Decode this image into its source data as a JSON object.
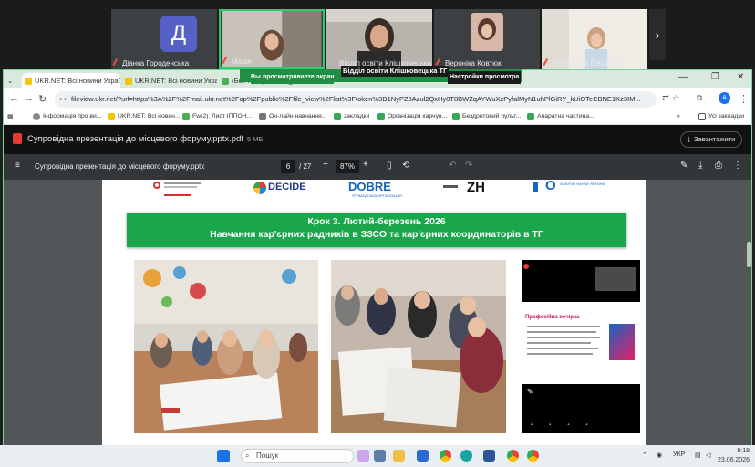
{
  "meeting": {
    "participants": [
      {
        "name": "Діанка Городенська",
        "initial": "Д"
      },
      {
        "name": "Марія"
      },
      {
        "name": "Відділ освіти Клішковецька ТГ"
      },
      {
        "name": "Вероніка Ковтюк"
      },
      {
        "name": "Катерина Василів..."
      }
    ],
    "banner_left": "Вы просматриваете экран",
    "banner_mid": "Відділ освіти Клішковецька ТГ",
    "banner_right": "Настройки просмотра"
  },
  "browser": {
    "tabs": [
      {
        "label": "UKR.NET: Всі новини України"
      },
      {
        "label": "UKR.NET: Всі новини Україн"
      },
      {
        "label": "(Без теми) - osvita_klishkivts..."
      }
    ],
    "url": "fileview.ukr.net/?url=https%3A%2F%2Fmail.ukr.net%2Fap%2Fpublic%2Ffile_view%2Flist%3Ftoken%3D1NyPZ8Azul2QxHy0T8BWZqAYWuXzPyfalMyN1uhPlGiRY_kUiOTeCBNE1Kz3IM...",
    "profile_initial": "A",
    "bookmarks": [
      {
        "label": "Інформація про ви..."
      },
      {
        "label": "UKR.NET: Всі новин..."
      },
      {
        "label": "Fw(2): Лист ІППОН..."
      },
      {
        "label": "Он-лайн навчання..."
      },
      {
        "label": "закладки"
      },
      {
        "label": "Організація харчув..."
      },
      {
        "label": "Бездротовий пульт..."
      },
      {
        "label": "Апаратна частина..."
      }
    ],
    "bookmarks_more": "»",
    "all_bookmarks": "Усі закладки"
  },
  "viewer": {
    "file_title": "Супровідна презентація до місцевого форуму.pptx.pdf",
    "file_size": "5 МБ",
    "download_label": "Завантажити",
    "pdf_title": "Супровідна презентація до місцевого форуму.pptx",
    "page_current": "6",
    "page_total": "/ 27",
    "zoom": "87%"
  },
  "slide": {
    "heading_line1": "Крок 3. Лютий-березень 2026",
    "heading_line2": "Навчання кар'єрних радників в ЗЗСО та кар'єрних координаторів в ТГ",
    "logo_decide": "DECIDE",
    "logo_dobre": "DOBRE",
    "logo_org": "ГРОМАДСЬКА ОРГАНІЗАЦІЯ",
    "logo_zn": "ZH",
    "logo_min": "О",
    "logo_min_text": "ОСВІТИ І НАУКИ УКРАЇНИ",
    "phone_screen_title": "Професійна вечірка"
  },
  "taskbar": {
    "search_placeholder": "Пошук",
    "lang": "УКР",
    "time": "9:18",
    "date": "23.06.2026"
  },
  "colors": {
    "accent_green": "#1aa64a",
    "banner_green": "#1f8f46",
    "pdf_toolbar": "#323639"
  }
}
